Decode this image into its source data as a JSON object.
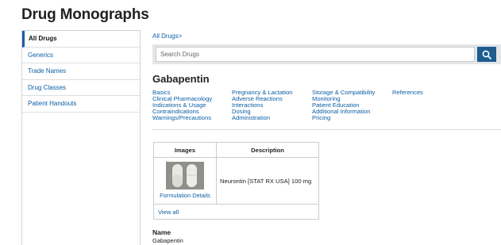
{
  "header": {
    "title": "Drug Monographs"
  },
  "sidebar": {
    "items": [
      {
        "label": "All Drugs"
      },
      {
        "label": "Generics"
      },
      {
        "label": "Trade Names"
      },
      {
        "label": "Drug Classes"
      },
      {
        "label": "Patient Handouts"
      }
    ]
  },
  "breadcrumb": {
    "label": "All Drugs>"
  },
  "search": {
    "placeholder": "Search Drugs",
    "button_icon": "search-icon"
  },
  "drug": {
    "name": "Gabapentin",
    "sections": [
      [
        "Basics",
        "Clinical Pharmacology",
        "Indications & Usage",
        "Contraindications",
        "Warnings/Precautions"
      ],
      [
        "Pregnancy & Lactation",
        "Adverse Reactions",
        "Interactions",
        "Dosing",
        "Administration"
      ],
      [
        "Storage & Compatibility",
        "Monitoring",
        "Patient Education",
        "Additional Information",
        "Pricing"
      ],
      [
        "References"
      ]
    ]
  },
  "images_table": {
    "headers": [
      "Images",
      "Description"
    ],
    "rows": [
      {
        "link": "Formulation Details",
        "description": "Neurontin [STAT RX USA] 100 mg"
      }
    ],
    "view_all": "View all"
  },
  "name_section": {
    "label": "Name",
    "value": "Gabapentin"
  },
  "colors": {
    "accent": "#1d5c8f",
    "link": "#0b5fa5"
  }
}
